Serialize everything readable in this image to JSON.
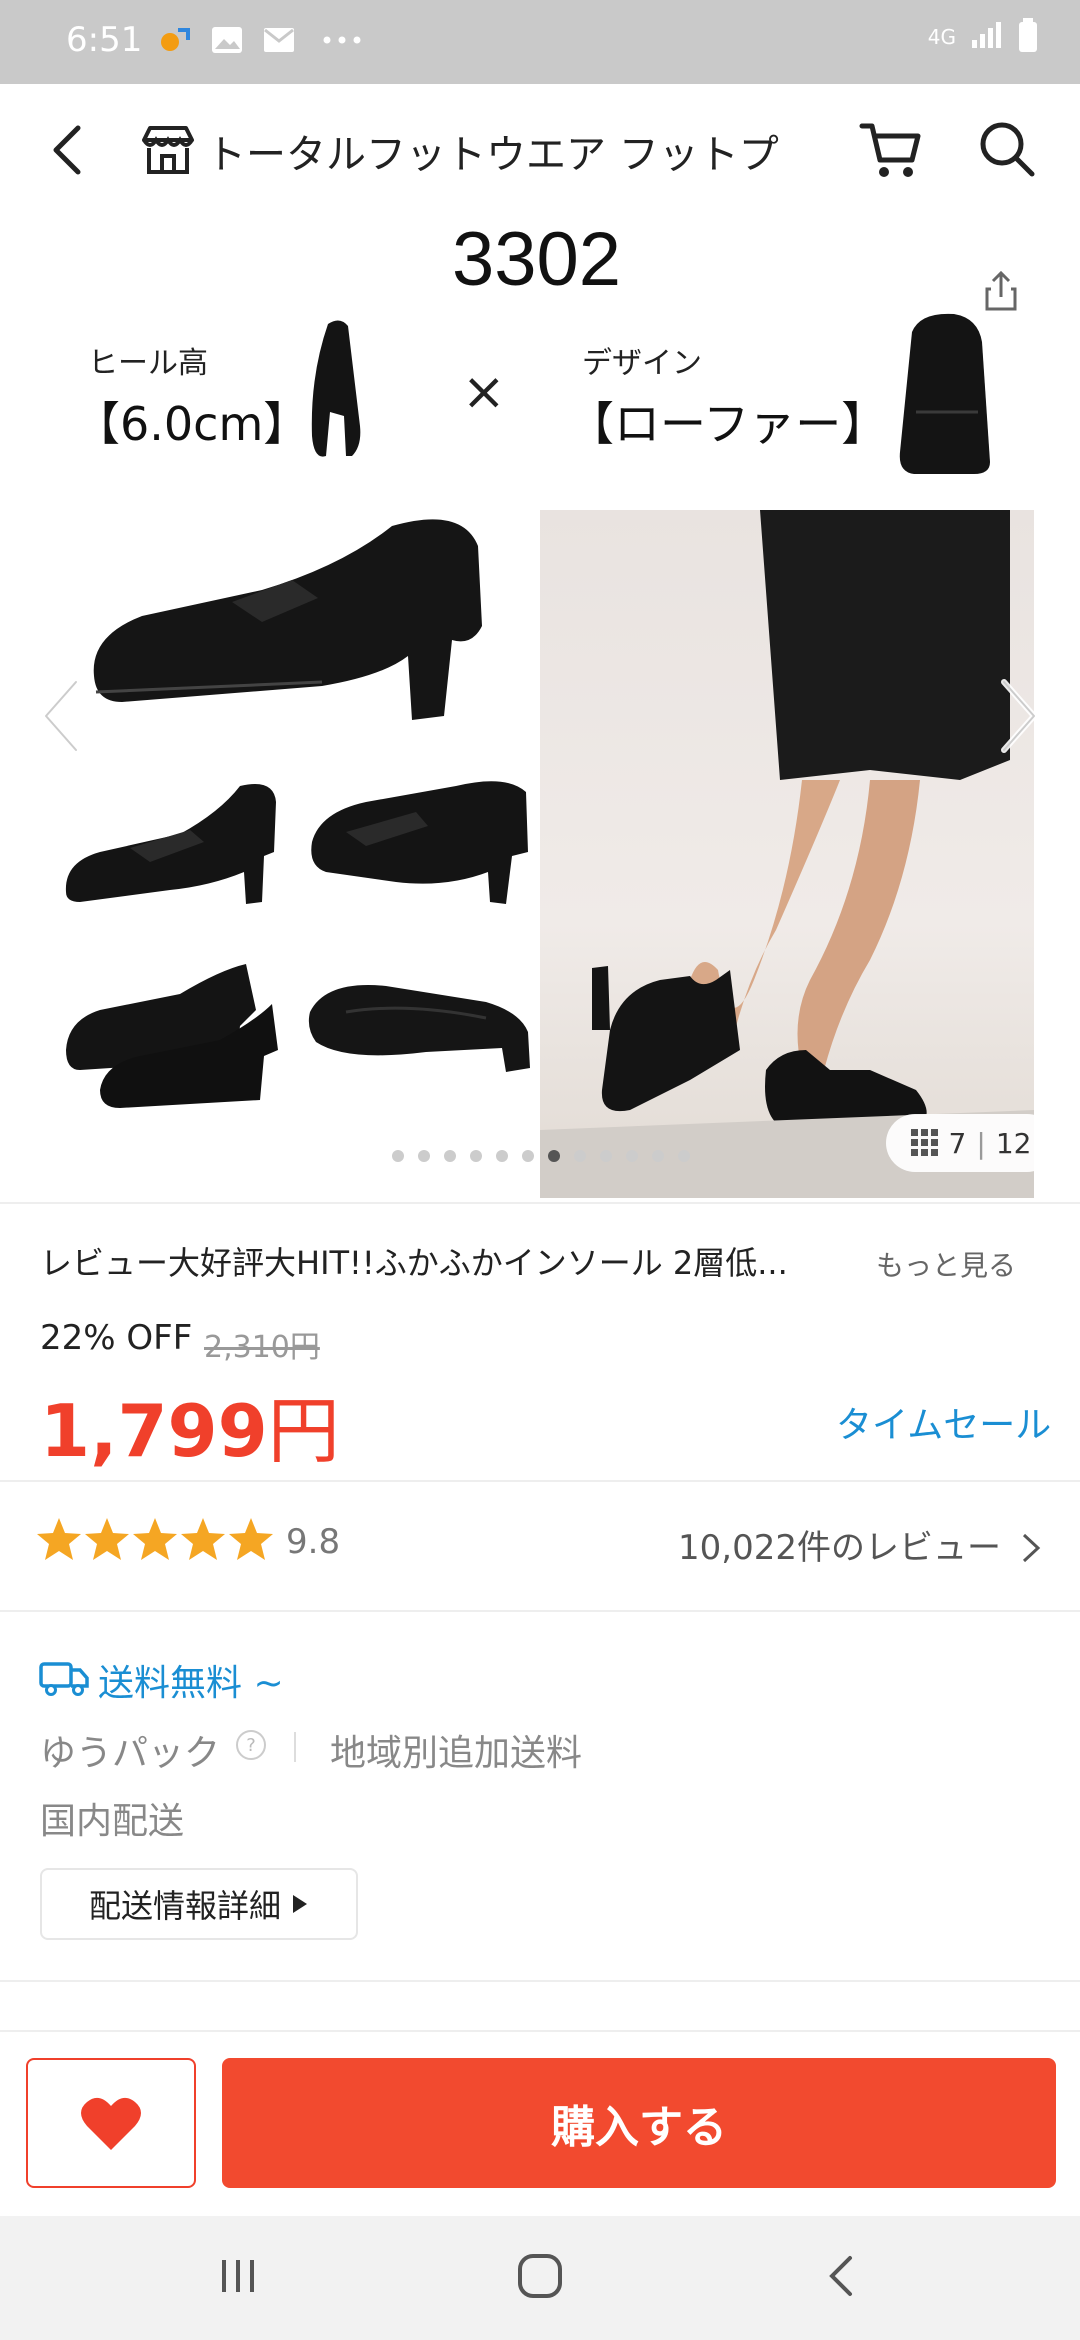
{
  "status_bar": {
    "time": "6:51",
    "network": "4G"
  },
  "header": {
    "store_name": "トータルフットウエア フットプ"
  },
  "gallery": {
    "model": "3302",
    "heel_label": "ヒール高",
    "heel_value": "【6.0cm】",
    "times": "×",
    "design_label": "デザイン",
    "design_value": "【ローファー】",
    "current": "7",
    "total": "12",
    "dot_count": 12,
    "active_dot": 6
  },
  "product": {
    "title": "レビュー大好評大HIT!!ふかふかインソール 2層低...",
    "more": "もっと見る",
    "discount": "22% OFF",
    "original_price": "2,310円",
    "price": "1,799",
    "price_unit": "円",
    "time_sale": "タイムセール"
  },
  "rating": {
    "stars": 5,
    "score": "9.8",
    "reviews": "10,022件のレビュー"
  },
  "shipping": {
    "free": "送料無料 ~",
    "carrier": "ゆうパック",
    "help": "?",
    "regional": "地域別追加送料",
    "domestic": "国内配送",
    "detail_button": "配送情報詳細"
  },
  "actions": {
    "buy_label": "購入する"
  },
  "colors": {
    "accent": "#f24a2f",
    "link": "#1a8ed3",
    "star": "#f5a623"
  }
}
